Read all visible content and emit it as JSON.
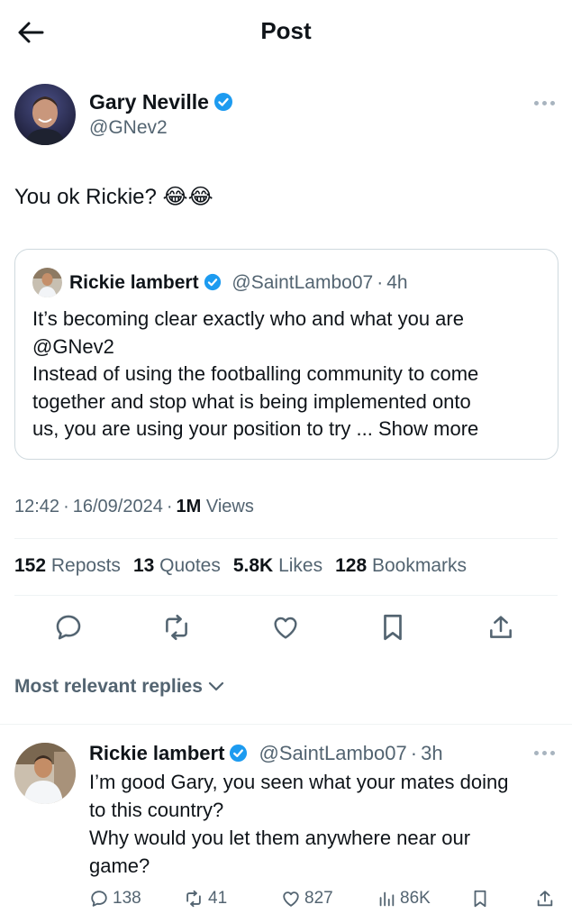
{
  "header": {
    "title": "Post"
  },
  "post": {
    "author_name": "Gary Neville",
    "author_handle": "@GNev2",
    "text": "You ok Rickie? 😂😂",
    "quote": {
      "author_name": "Rickie lambert",
      "author_handle": "@SaintLambo07",
      "separator": "·",
      "time": "4h",
      "lines": [
        "It’s becoming clear exactly who and what you are",
        "@GNev2",
        "Instead of using the footballing community to come",
        "together and stop what is being implemented onto",
        "us, you are using your position to try ..."
      ],
      "show_more": "Show more"
    },
    "time": "12:42",
    "dot1": "·",
    "date": "16/09/2024",
    "dot2": "·",
    "views_count": "1M",
    "views_label": "Views",
    "stats": {
      "reposts_count": "152",
      "reposts_label": "Reposts",
      "quotes_count": "13",
      "quotes_label": "Quotes",
      "likes_count": "5.8K",
      "likes_label": "Likes",
      "bookmarks_count": "128",
      "bookmarks_label": "Bookmarks"
    }
  },
  "replies_sort": {
    "label": "Most relevant replies"
  },
  "reply": {
    "author_name": "Rickie lambert",
    "author_handle": "@SaintLambo07",
    "separator": "·",
    "time": "3h",
    "lines": [
      "I’m good Gary, you seen what your mates doing",
      "to this country?",
      "Why would you let them anywhere near our",
      "game?"
    ],
    "replies": "138",
    "reposts": "41",
    "likes": "827",
    "views": "86K"
  },
  "colors": {
    "verified": "#1d9bf0",
    "text": "#0f1419",
    "secondary": "#536471",
    "border": "#cfd9de"
  },
  "icons": [
    "back-arrow-icon",
    "verified-icon",
    "more-icon",
    "reply-icon",
    "repost-icon",
    "like-icon",
    "bookmark-icon",
    "share-icon",
    "views-icon",
    "chevron-down-icon"
  ]
}
